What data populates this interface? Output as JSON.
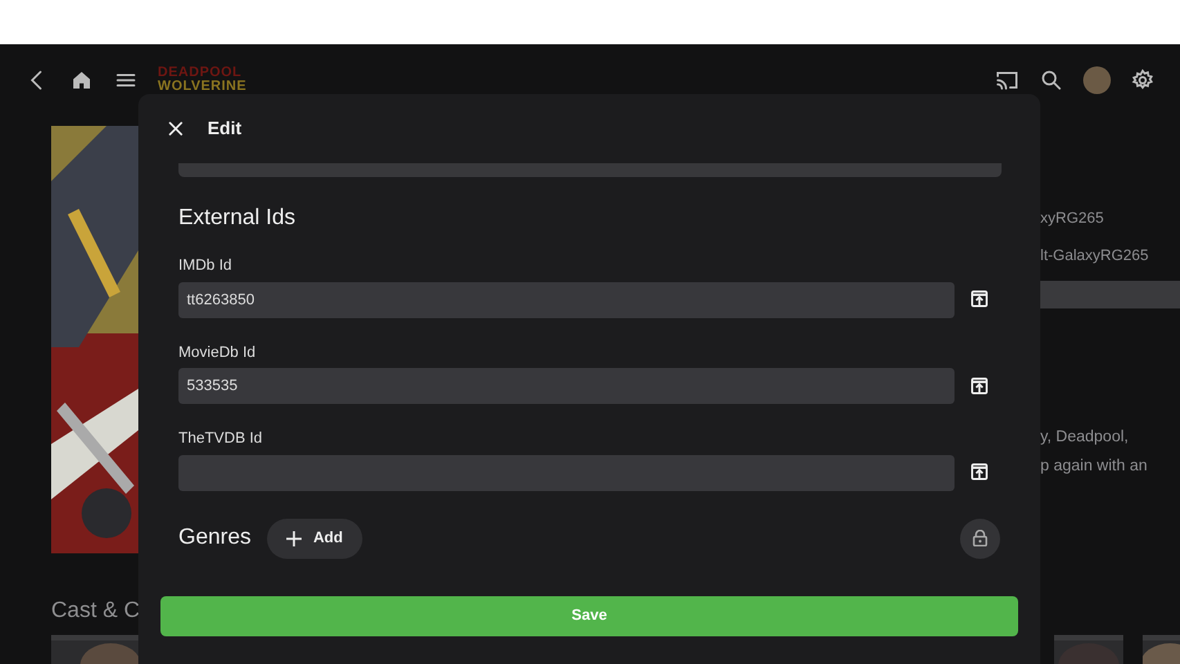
{
  "top_bar": {
    "logo_lines": [
      "DEADPOOL",
      "WOLVERINE"
    ]
  },
  "background": {
    "details": [
      "xyRG265",
      "lt-GalaxyRG265"
    ],
    "overview_lines": [
      "y, Deadpool,",
      "p again with an"
    ],
    "section_title": "Cast & C"
  },
  "dialog": {
    "title": "Edit",
    "section_title": "External Ids",
    "fields": [
      {
        "label": "IMDb Id",
        "value": "tt6263850"
      },
      {
        "label": "MovieDb Id",
        "value": "533535"
      },
      {
        "label": "TheTVDB Id"
      }
    ],
    "genres": {
      "title": "Genres",
      "add_label": "Add"
    },
    "save_label": "Save"
  }
}
